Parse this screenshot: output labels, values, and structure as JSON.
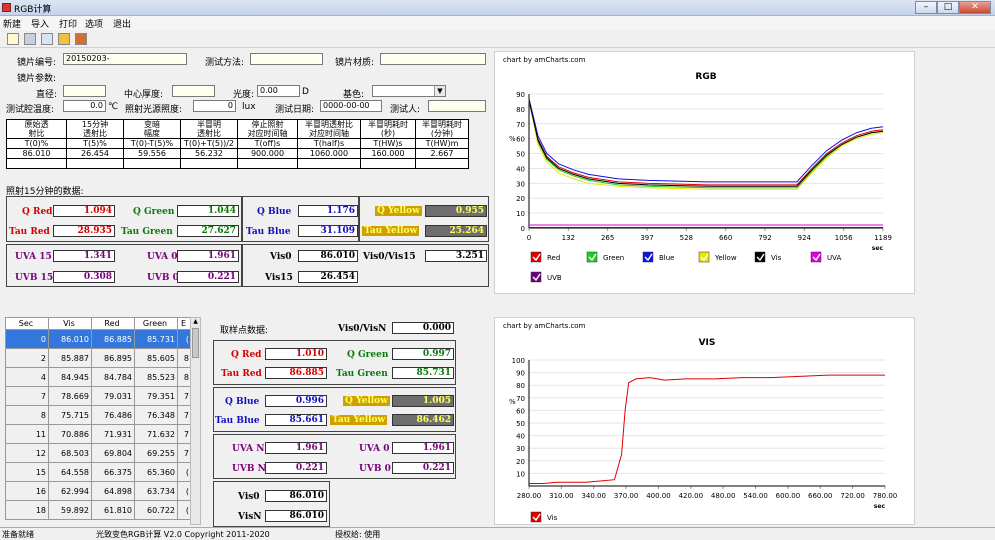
{
  "window": {
    "title": "RGB计算",
    "min": "–",
    "max": "□",
    "close": "✕"
  },
  "menu": [
    "新建",
    "导入",
    "打印",
    "选项",
    "退出"
  ],
  "form": {
    "lens_no_label": "镜片编号:",
    "lens_no": "20150203-",
    "test_method_label": "测试方法:",
    "test_method": "",
    "lens_material_label": "镜片材质:",
    "lens_material": "",
    "lens_params_label": "镜片参数:",
    "diameter_label": "直径:",
    "diameter": "",
    "center_thickness_label": "中心厚度:",
    "center_thickness": "",
    "power_label": "光度:",
    "power": "0.00",
    "power_unit": "D",
    "base_color_label": "基色:",
    "base_color": "",
    "chamber_temp_label": "测试腔温度:",
    "chamber_temp": "0.0",
    "temp_unit": "℃",
    "illum_label": "照射光源照度:",
    "illum": "0",
    "illum_unit": "lux",
    "test_date_label": "测试日期:",
    "test_date": "0000-00-00",
    "tester_label": "测试人:",
    "tester": ""
  },
  "params_table": {
    "headers": [
      [
        "原始透",
        "射比"
      ],
      [
        "15分钟",
        "透射比"
      ],
      [
        "变暗",
        "幅度"
      ],
      [
        "半冒明",
        "透射比"
      ],
      [
        "停止照射",
        "对应时间轴"
      ],
      [
        "半冒明透射比",
        "对应时间轴"
      ],
      [
        "半冒明耗时",
        "(秒)"
      ],
      [
        "半冒明耗时",
        "(分钟)"
      ]
    ],
    "symbols": [
      "T(0)%",
      "T(5)%",
      "T(0)-T(5)%",
      "T(0)+T(5))/2",
      "T(off)s",
      "T(half)s",
      "T(HW)s",
      "T(HW)m"
    ],
    "values": [
      "86.010",
      "26.454",
      "59.556",
      "56.232",
      "900.000",
      "1060.000",
      "160.000",
      "2.667"
    ]
  },
  "irr15": {
    "section_label": "照射15分钟的数据:",
    "q_red_l": "Q Red",
    "q_red": "1.094",
    "q_green_l": "Q Green",
    "q_green": "1.044",
    "q_blue_l": "Q Blue",
    "q_blue": "1.176",
    "q_yellow_l": "Q Yellow",
    "q_yellow": "0.955",
    "tau_red_l": "Tau Red",
    "tau_red": "28.935",
    "tau_green_l": "Tau Green",
    "tau_green": "27.627",
    "tau_blue_l": "Tau Blue",
    "tau_blue": "31.109",
    "tau_yellow_l": "Tau Yellow",
    "tau_yellow": "25.264",
    "uva15_l": "UVA 15",
    "uva15": "1.341",
    "uva0_l": "UVA 0",
    "uva0": "1.961",
    "vis0_l": "Vis0",
    "vis0": "86.010",
    "visratio_l": "Vis0/Vis15",
    "visratio": "3.251",
    "uvb15_l": "UVB 15",
    "uvb15": "0.308",
    "uvb0_l": "UVB 0",
    "uvb0": "0.221",
    "vis15_l": "Vis15",
    "vis15": "26.454"
  },
  "grid": {
    "headers": [
      "Sec",
      "Vis",
      "Red",
      "Green",
      "E"
    ],
    "rows": [
      [
        "0",
        "86.010",
        "86.885",
        "85.731",
        "("
      ],
      [
        "2",
        "85.887",
        "86.895",
        "85.605",
        "8"
      ],
      [
        "4",
        "84.945",
        "84.784",
        "85.523",
        "8"
      ],
      [
        "7",
        "78.669",
        "79.031",
        "79.351",
        "7"
      ],
      [
        "8",
        "75.715",
        "76.486",
        "76.348",
        "7"
      ],
      [
        "11",
        "70.886",
        "71.931",
        "71.632",
        "7"
      ],
      [
        "12",
        "68.503",
        "69.804",
        "69.255",
        "7"
      ],
      [
        "15",
        "64.558",
        "66.375",
        "65.360",
        "("
      ],
      [
        "16",
        "62.994",
        "64.898",
        "63.734",
        "("
      ],
      [
        "18",
        "59.892",
        "61.810",
        "60.722",
        "("
      ]
    ]
  },
  "sample": {
    "section_label": "取样点数据:",
    "visn_ratio_l": "Vis0/VisN",
    "visn_ratio": "0.000",
    "q_red_l": "Q Red",
    "q_red": "1.010",
    "q_green_l": "Q Green",
    "q_green": "0.997",
    "tau_red_l": "Tau Red",
    "tau_red": "86.885",
    "tau_green_l": "Tau Green",
    "tau_green": "85.731",
    "q_blue_l": "Q Blue",
    "q_blue": "0.996",
    "q_yellow_l": "Q Yellow",
    "q_yellow": "1.005",
    "tau_blue_l": "Tau Blue",
    "tau_blue": "85.661",
    "tau_yellow_l": "Tau Yellow",
    "tau_yellow": "86.462",
    "uvan_l": "UVA N",
    "uvan": "1.961",
    "uva0_l": "UVA 0",
    "uva0": "1.961",
    "uvbn_l": "UVB N",
    "uvbn": "0.221",
    "uvb0_l": "UVB 0",
    "uvb0": "0.221",
    "vis0_l": "Vis0",
    "vis0": "86.010",
    "visn_l": "VisN",
    "visn": "86.010"
  },
  "status": {
    "ready": "准备就绪",
    "copyright": "光致变色RGB计算 V2.0 Copyright 2011-2020",
    "license": "授权给: 使用"
  },
  "chart_data": [
    {
      "type": "line",
      "credit": "chart by amCharts.com",
      "title": "RGB",
      "ylabel": "%",
      "xlabel": "sec",
      "ylim": [
        0,
        90
      ],
      "yticks": [
        0,
        10,
        20,
        30,
        40,
        50,
        60,
        70,
        80,
        90
      ],
      "xticks": [
        "0",
        "132",
        "265",
        "397",
        "528",
        "660",
        "792",
        "924",
        "1056",
        "1189"
      ],
      "x": [
        0,
        30,
        60,
        100,
        150,
        200,
        300,
        400,
        500,
        600,
        700,
        800,
        880,
        900,
        950,
        1000,
        1050,
        1100,
        1150,
        1189
      ],
      "series": [
        {
          "name": "Red",
          "color": "#e00000",
          "values": [
            86,
            60,
            48,
            41,
            37,
            34,
            31,
            30,
            29.5,
            29,
            29,
            29,
            29,
            29,
            40,
            50,
            57,
            62,
            65,
            66
          ]
        },
        {
          "name": "Green",
          "color": "#22cc22",
          "values": [
            85,
            58,
            46,
            39,
            35,
            32,
            29,
            28,
            27.5,
            27,
            27,
            27,
            27,
            27,
            38,
            48,
            56,
            61,
            64,
            65
          ]
        },
        {
          "name": "Blue",
          "color": "#1010e0",
          "values": [
            87,
            62,
            50,
            43,
            39,
            36,
            33,
            32,
            31.5,
            31,
            31,
            31,
            31,
            31,
            42,
            52,
            59,
            64,
            67,
            68
          ]
        },
        {
          "name": "Yellow",
          "color": "#e8e800",
          "values": [
            86,
            56,
            44,
            37,
            33,
            30,
            28,
            27,
            26.5,
            26,
            26,
            26,
            26,
            26,
            37,
            47,
            55,
            60,
            63,
            64
          ]
        },
        {
          "name": "Vis",
          "color": "#000000",
          "values": [
            86,
            59,
            47,
            40,
            36,
            33,
            30,
            29,
            28.5,
            28,
            28,
            28,
            28,
            28,
            39,
            49,
            56,
            61,
            64,
            65
          ]
        },
        {
          "name": "UVA",
          "color": "#e000e0",
          "values": [
            2,
            2,
            2,
            2,
            2,
            2,
            2,
            2,
            2,
            2,
            2,
            2,
            2,
            2,
            2,
            2,
            2,
            2,
            2,
            2
          ]
        },
        {
          "name": "UVB",
          "color": "#6a0080",
          "values": [
            0.3,
            0.3,
            0.3,
            0.3,
            0.3,
            0.3,
            0.3,
            0.3,
            0.3,
            0.3,
            0.3,
            0.3,
            0.3,
            0.3,
            0.3,
            0.3,
            0.3,
            0.3,
            0.3,
            0.3
          ]
        }
      ]
    },
    {
      "type": "line",
      "credit": "chart by amCharts.com",
      "title": "VIS",
      "ylabel": "%",
      "xlabel": "sec",
      "ylim": [
        0,
        100
      ],
      "yticks": [
        10,
        20,
        30,
        40,
        50,
        60,
        70,
        80,
        90,
        100
      ],
      "xticks": [
        "280.00",
        "310.00",
        "340.00",
        "370.00",
        "400.00",
        "420.00",
        "480.00",
        "540.00",
        "600.00",
        "660.00",
        "720.00",
        "780.00"
      ],
      "x": [
        280,
        300,
        320,
        340,
        360,
        380,
        400,
        410,
        415,
        420,
        430,
        450,
        470,
        500,
        540,
        580,
        620,
        660,
        700,
        740,
        780
      ],
      "series": [
        {
          "name": "Vis",
          "color": "#e00000",
          "values": [
            2,
            2,
            3,
            3,
            3,
            4,
            5,
            25,
            60,
            82,
            85,
            86,
            84,
            85,
            85,
            86,
            86,
            87,
            88,
            88,
            88
          ]
        }
      ]
    }
  ]
}
